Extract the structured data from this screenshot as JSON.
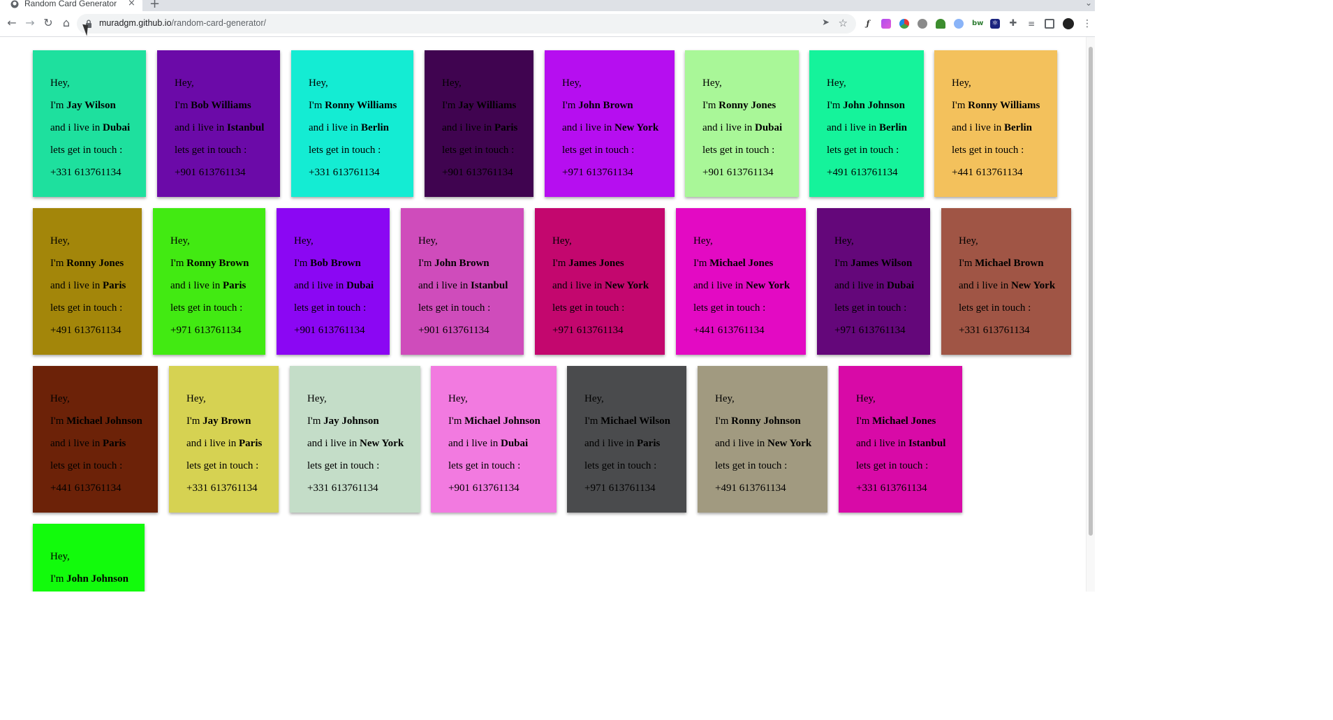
{
  "browser": {
    "tab_title": "Random Card Generator",
    "tab_close": "×",
    "new_tab": "+",
    "url_host": "muradgm.github.io",
    "url_path": "/random-card-generator/"
  },
  "card_text": {
    "greeting": "Hey,",
    "intro": "I'm",
    "live": "and i live in",
    "touch": "lets get in touch :"
  },
  "cards": [
    {
      "name": "Jay Wilson",
      "city": "Dubai",
      "phone": "+331 613761134",
      "color": "#1ee09e"
    },
    {
      "name": "Bob Williams",
      "city": "Istanbul",
      "phone": "+901 613761134",
      "color": "#6b0aa8"
    },
    {
      "name": "Ronny Williams",
      "city": "Berlin",
      "phone": "+331 613761134",
      "color": "#14ecd3"
    },
    {
      "name": "Jay Williams",
      "city": "Paris",
      "phone": "+901 613761134",
      "color": "#400450"
    },
    {
      "name": "John Brown",
      "city": "New York",
      "phone": "+971 613761134",
      "color": "#b60ef0"
    },
    {
      "name": "Ronny Jones",
      "city": "Dubai",
      "phone": "+901 613761134",
      "color": "#a9f798"
    },
    {
      "name": "John Johnson",
      "city": "Berlin",
      "phone": "+491 613761134",
      "color": "#15f39b"
    },
    {
      "name": "Ronny Williams",
      "city": "Berlin",
      "phone": "+441 613761134",
      "color": "#f3c15c"
    },
    {
      "name": "Ronny Jones",
      "city": "Paris",
      "phone": "+491 613761134",
      "color": "#a3860a"
    },
    {
      "name": "Ronny Brown",
      "city": "Paris",
      "phone": "+971 613761134",
      "color": "#42ea12"
    },
    {
      "name": "Bob Brown",
      "city": "Dubai",
      "phone": "+901 613761134",
      "color": "#8b07f3"
    },
    {
      "name": "John Brown",
      "city": "Istanbul",
      "phone": "+901 613761134",
      "color": "#cf4cbb"
    },
    {
      "name": "James Jones",
      "city": "New York",
      "phone": "+971 613761134",
      "color": "#c3076e"
    },
    {
      "name": "Michael Jones",
      "city": "New York",
      "phone": "+441 613761134",
      "color": "#e30ac3"
    },
    {
      "name": "James Wilson",
      "city": "Dubai",
      "phone": "+971 613761134",
      "color": "#64077a"
    },
    {
      "name": "Michael Brown",
      "city": "New York",
      "phone": "+331 613761134",
      "color": "#a05545"
    },
    {
      "name": "Michael Johnson",
      "city": "Paris",
      "phone": "+441 613761134",
      "color": "#6c2208"
    },
    {
      "name": "Jay Brown",
      "city": "Paris",
      "phone": "+331 613761134",
      "color": "#d6d252"
    },
    {
      "name": "Jay Johnson",
      "city": "New York",
      "phone": "+331 613761134",
      "color": "#c4ddc8"
    },
    {
      "name": "Michael Johnson",
      "city": "Dubai",
      "phone": "+901 613761134",
      "color": "#f27ae0"
    },
    {
      "name": "Michael Wilson",
      "city": "Paris",
      "phone": "+971 613761134",
      "color": "#4a4b4d"
    },
    {
      "name": "Ronny Johnson",
      "city": "New York",
      "phone": "+491 613761134",
      "color": "#a19a80"
    },
    {
      "name": "Michael Jones",
      "city": "Istanbul",
      "phone": "+331 613761134",
      "color": "#d80aa7"
    },
    {
      "name": "John Johnson",
      "city": "",
      "phone": "",
      "color": "#12fb0c"
    }
  ]
}
